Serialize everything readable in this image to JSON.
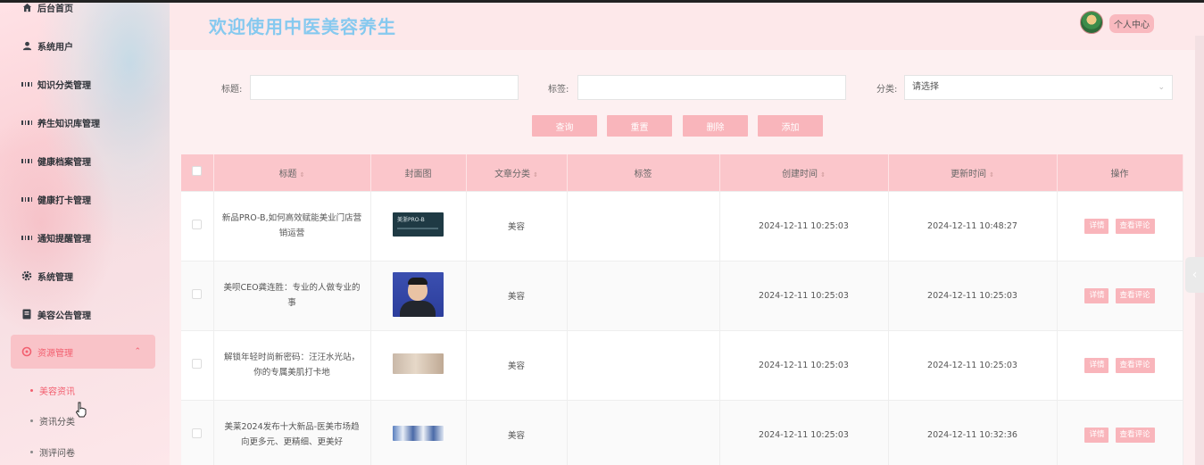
{
  "sidebar": {
    "items": [
      {
        "label": "后台首页",
        "icon": "home-icon"
      },
      {
        "label": "系统用户",
        "icon": "user-icon"
      },
      {
        "label": "知识分类管理",
        "icon": "grid-icon"
      },
      {
        "label": "养生知识库管理",
        "icon": "grid-icon"
      },
      {
        "label": "健康档案管理",
        "icon": "grid-icon"
      },
      {
        "label": "健康打卡管理",
        "icon": "grid-icon"
      },
      {
        "label": "通知提醒管理",
        "icon": "grid-icon"
      },
      {
        "label": "系统管理",
        "icon": "gear-icon"
      },
      {
        "label": "美容公告管理",
        "icon": "document-icon"
      },
      {
        "label": "资源管理",
        "icon": "resource-icon"
      }
    ],
    "sub_items": [
      {
        "label": "美容资讯"
      },
      {
        "label": "资讯分类"
      },
      {
        "label": "测评问卷"
      }
    ],
    "active_color": "#f25f6f"
  },
  "header": {
    "welcome": "欢迎使用中医美容养生",
    "profile_label": "个人中心"
  },
  "search": {
    "title_label": "标题:",
    "tag_label": "标签:",
    "category_label": "分类:",
    "category_placeholder": "请选择"
  },
  "buttons": {
    "query": "查询",
    "reset": "重置",
    "delete": "删除",
    "add": "添加"
  },
  "table": {
    "headers": {
      "title": "标题",
      "cover": "封面图",
      "category": "文章分类",
      "tags": "标签",
      "created": "创建时间",
      "updated": "更新时间",
      "ops": "操作"
    },
    "rows": [
      {
        "title": "新品PRO-B,如何高效赋能美业门店营销运营",
        "category": "美容",
        "tags": "",
        "created": "2024-12-11 10:25:03",
        "updated": "2024-12-11 10:48:27",
        "detail": "详情",
        "comments": "查看评论",
        "thumb_text": "美浙PRO-B"
      },
      {
        "title": "美呗CEO龚连胜：专业的人做专业的事",
        "category": "美容",
        "tags": "",
        "created": "2024-12-11 10:25:03",
        "updated": "2024-12-11 10:25:03",
        "detail": "详情",
        "comments": "查看评论"
      },
      {
        "title": "解锁年轻时尚新密码：汪汪水光站，你的专属美肌打卡地",
        "category": "美容",
        "tags": "",
        "created": "2024-12-11 10:25:03",
        "updated": "2024-12-11 10:25:03",
        "detail": "详情",
        "comments": "查看评论"
      },
      {
        "title": "美莱2024发布十大新品-医美市场趋向更多元、更精细、更美好",
        "category": "美容",
        "tags": "",
        "created": "2024-12-11 10:25:03",
        "updated": "2024-12-11 10:32:36",
        "detail": "详情",
        "comments": "查看评论"
      }
    ]
  }
}
